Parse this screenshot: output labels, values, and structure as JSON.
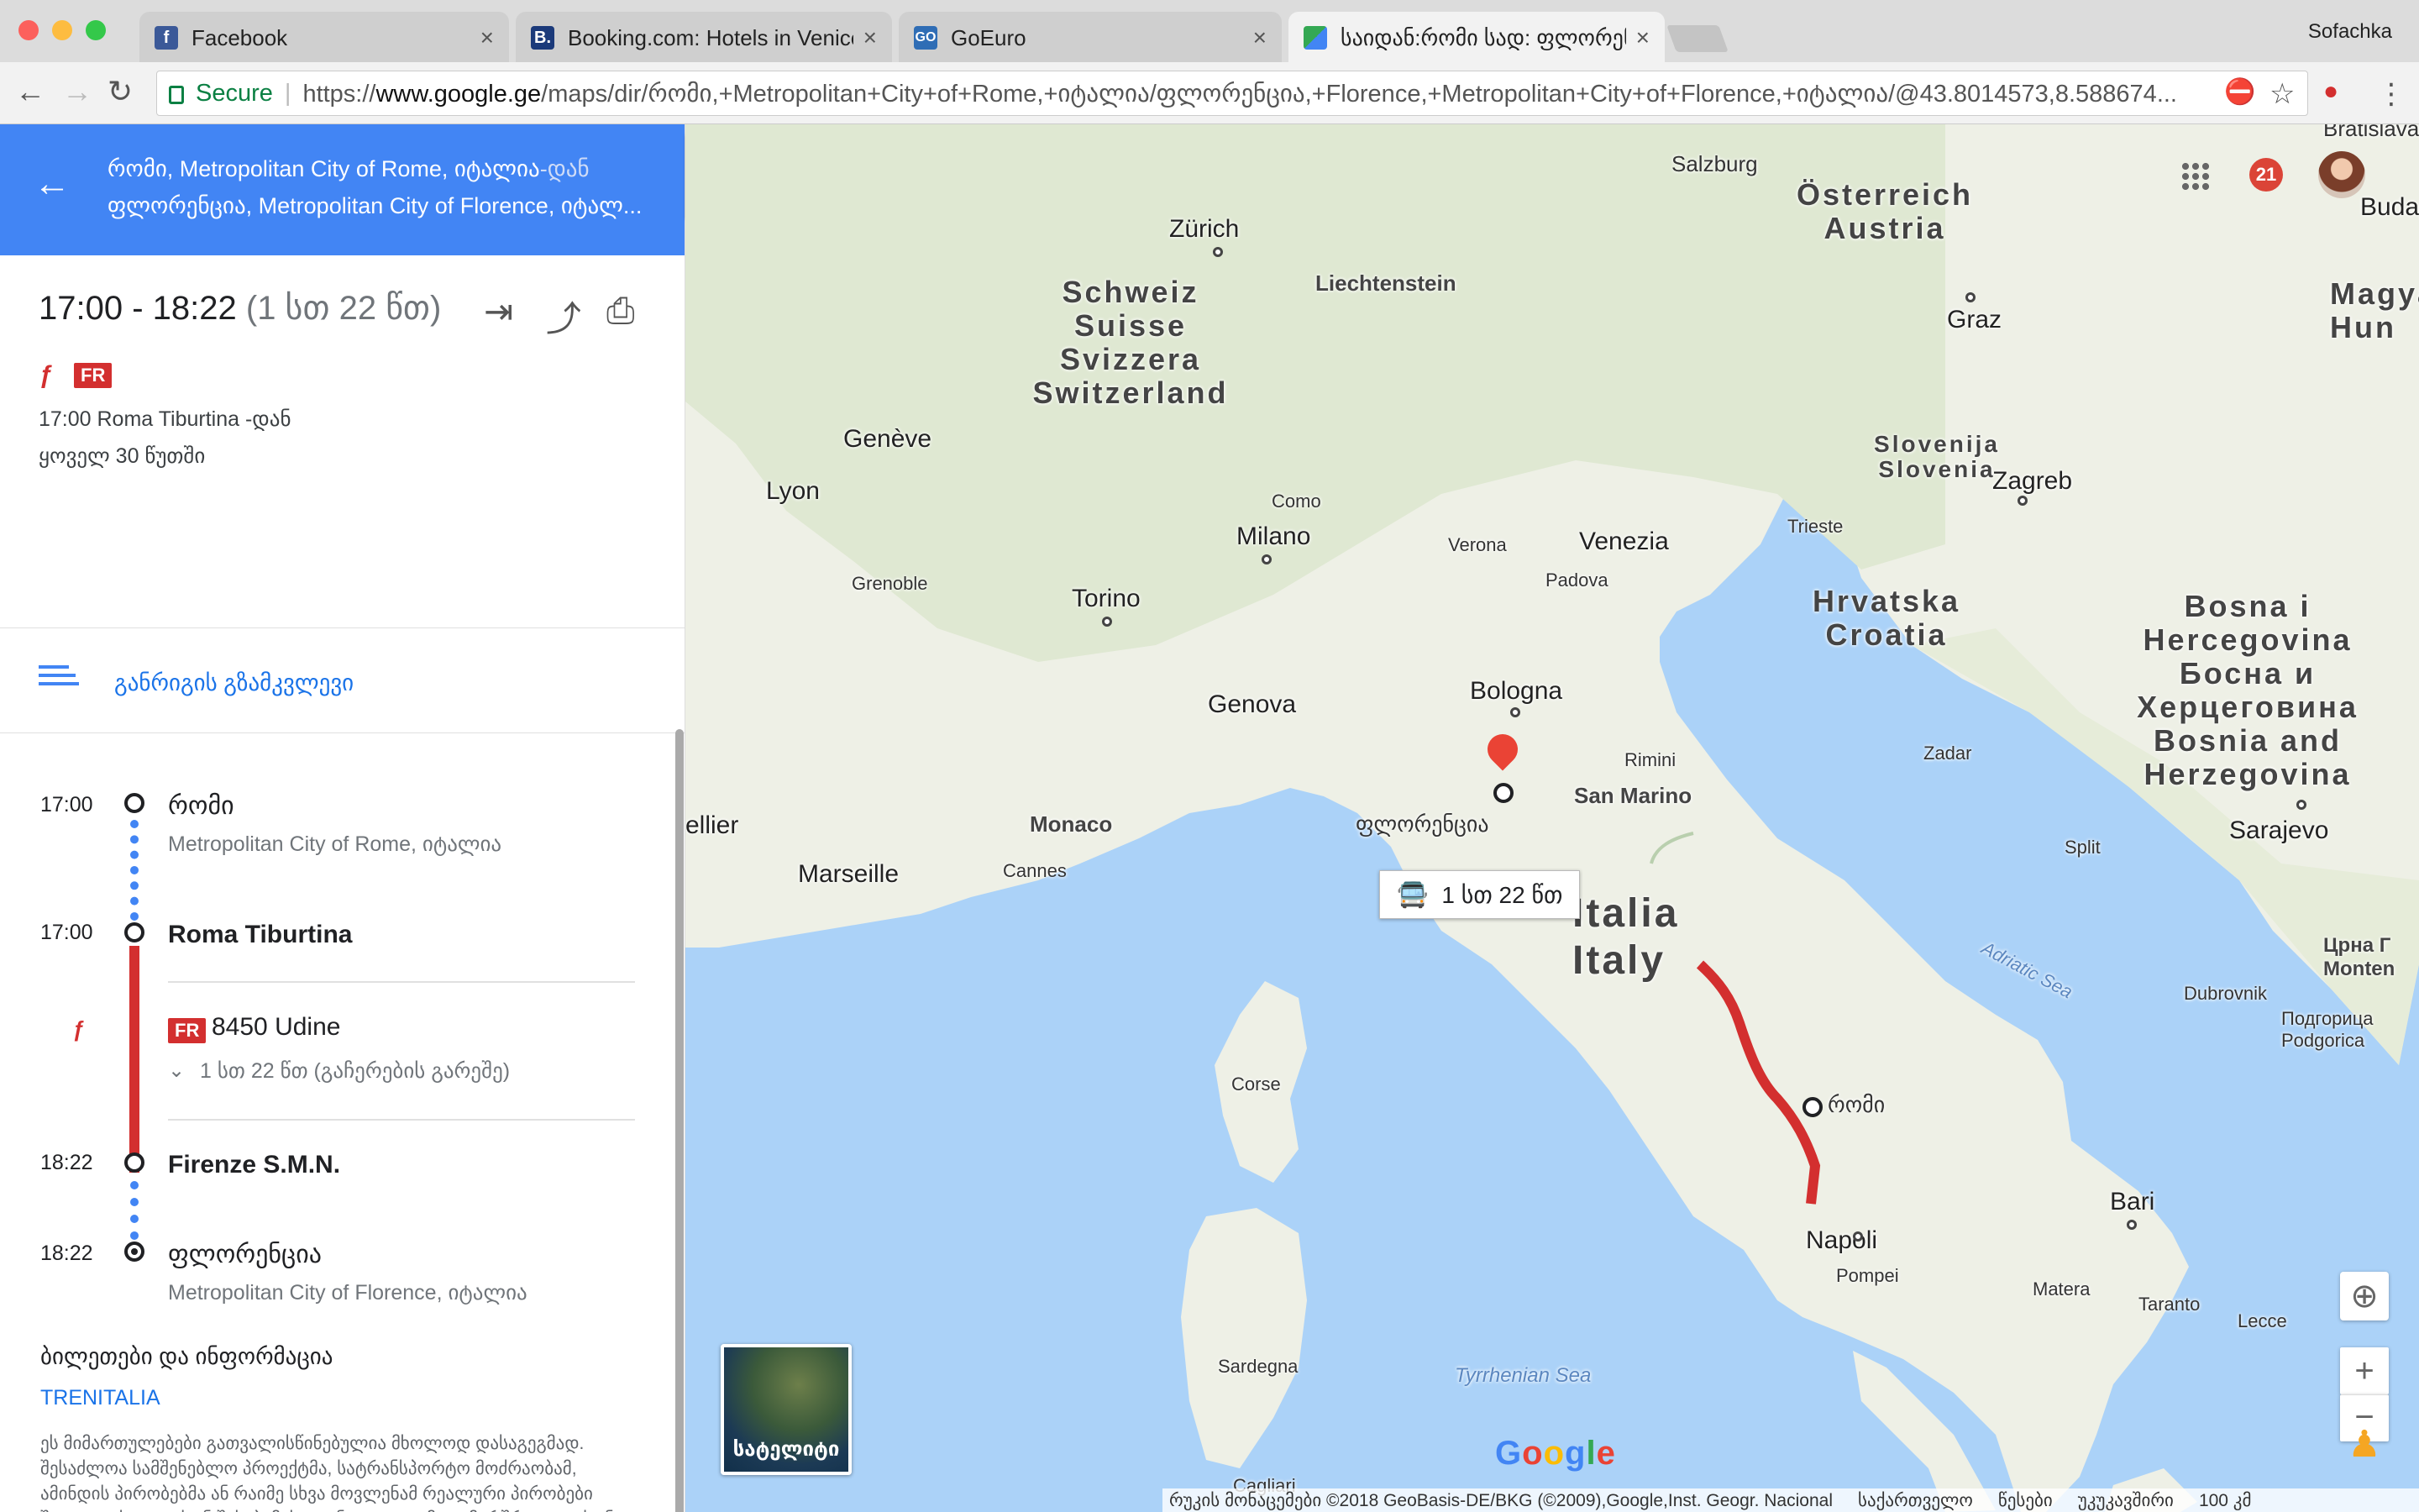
{
  "browser": {
    "profile": "Sofachka",
    "tabs": [
      {
        "title": "Facebook",
        "favicon": "f",
        "color": "#3b5998"
      },
      {
        "title": "Booking.com: Hotels in Venice",
        "favicon": "B.",
        "color": "#1b3a7a"
      },
      {
        "title": "GoEuro",
        "favicon": "GO",
        "color": "#2f6db5"
      },
      {
        "title": "საიდან:რომი სად: ფლორენ",
        "favicon": "maps-icon",
        "color": "#34a853"
      }
    ],
    "secure_label": "Secure",
    "url_scheme": "https://",
    "url_host": "www.google.ge",
    "url_path": "/maps/dir/რომი,+Metropolitan+City+of+Rome,+იტალია/ფლორენცია,+Florence,+Metropolitan+City+of+Florence,+იტალია/@43.8014573,8.588674..."
  },
  "directions": {
    "origin": "რომი, Metropolitan City of Rome, იტალია",
    "origin_suffix": "-დან",
    "destination": "ფლორენცია, Metropolitan City of Florence, იტალ...",
    "time_range": "17:00 - 18:22",
    "duration": "(1 სთ 22 წთ)",
    "line_badge": "FR",
    "depart_info": "17:00 Roma Tiburtina -დან",
    "frequency": "ყოველ 30 წუთში",
    "steps_label": "განრიგის გზამკვლევი"
  },
  "timeline": {
    "start_time": "17:00",
    "start_name": "რომი",
    "start_sub": "Metropolitan City of Rome, იტალია",
    "board_time": "17:00",
    "board_station": "Roma Tiburtina",
    "train_badge": "FR",
    "train_name": "8450 Udine",
    "ride_info": "1 სთ 22 წთ (გაჩერების გარეშე)",
    "alight_time": "18:22",
    "alight_station": "Firenze S.M.N.",
    "end_time": "18:22",
    "end_name": "ფლორენცია",
    "end_sub": "Metropolitan City of Florence, იტალია"
  },
  "info": {
    "tickets_heading": "ბილეთები და ინფორმაცია",
    "operator": "TRENITALIA",
    "disclaimer": "ეს მიმართულებები გათვალისწინებულია მხოლოდ დასაგეგმად. შესაძლოა სამშენებლო პროექტმა, სატრანსპორტო მოძრაობამ, ამინდის პირობებმა ან რაიმე სხვა მოვლენამ რეალური პირობები შეცვალოს და თქვენ შესაბამისად უნდა დაგეგმოთ მარშრუტი. თქვენ უნდა დაემორჩილოთ მარშრუტთან დაკავშირებულ ყველა ნიშანს და შეტყობინებას."
  },
  "map": {
    "notification_count": "21",
    "route_duration": "1 სთ 22 წთ",
    "satellite_label": "სატელიტი",
    "google_logo": "Google",
    "footer": {
      "data_credit": "რუკის მონაცემები ©2018 GeoBasis-DE/BKG (©2009),Google,Inst. Geogr. Nacional",
      "terms_link": "საქართველო",
      "privacy_link": "წესები",
      "feedback_link": "უკუკავშირი",
      "scale_label": "100 კმ"
    },
    "countries": {
      "austria": "Österreich\nAustria",
      "switzerland": "Schweiz\nSuisse\nSvizzera\nSwitzerland",
      "liechtenstein": "Liechtenstein",
      "slovenia": "Slovenija\nSlovenia",
      "croatia": "Hrvatska\nCroatia",
      "bosnia": "Bosna i\nHercegovina\nБосна и\nХерцеговина\nBosnia and\nHerzegovina",
      "italy": "Italia\nItaly",
      "hungary": "Magya\nHun",
      "sanmarino": "San Marino",
      "monaco": "Monaco",
      "montenegro": "Црна Г\nMonten"
    },
    "cities": {
      "zurich": "Zürich",
      "salzburg": "Salzburg",
      "graz": "Graz",
      "bratislava": "Bratislava",
      "budapest": "Budapes",
      "geneve": "Genève",
      "lyon": "Lyon",
      "grenoble": "Grenoble",
      "torino": "Torino",
      "milano": "Milano",
      "como": "Como",
      "verona": "Verona",
      "padova": "Padova",
      "venezia": "Venezia",
      "trieste": "Trieste",
      "zagreb": "Zagreb",
      "bologna": "Bologna",
      "genova": "Genova",
      "rimini": "Rimini",
      "zadar": "Zadar",
      "sarajevo": "Sarajevo",
      "split": "Split",
      "marseille": "Marseille",
      "cannes": "Cannes",
      "montpellier": "ellier",
      "florence": "ფლორენცია",
      "rome": "რომი",
      "corse": "Corse",
      "sardegna": "Sardegna",
      "napoli": "Napoli",
      "pompei": "Pompei",
      "bari": "Bari",
      "matera": "Matera",
      "lecce": "Lecce",
      "taranto": "Taranto",
      "dubrovnik": "Dubrovnik",
      "podgorica": "Подгорица\nPodgorica",
      "cagliari": "Cagliari"
    },
    "seas": {
      "adriatic": "Adriatic Sea",
      "tyrrhenian": "Tyrrhenian Sea"
    }
  }
}
